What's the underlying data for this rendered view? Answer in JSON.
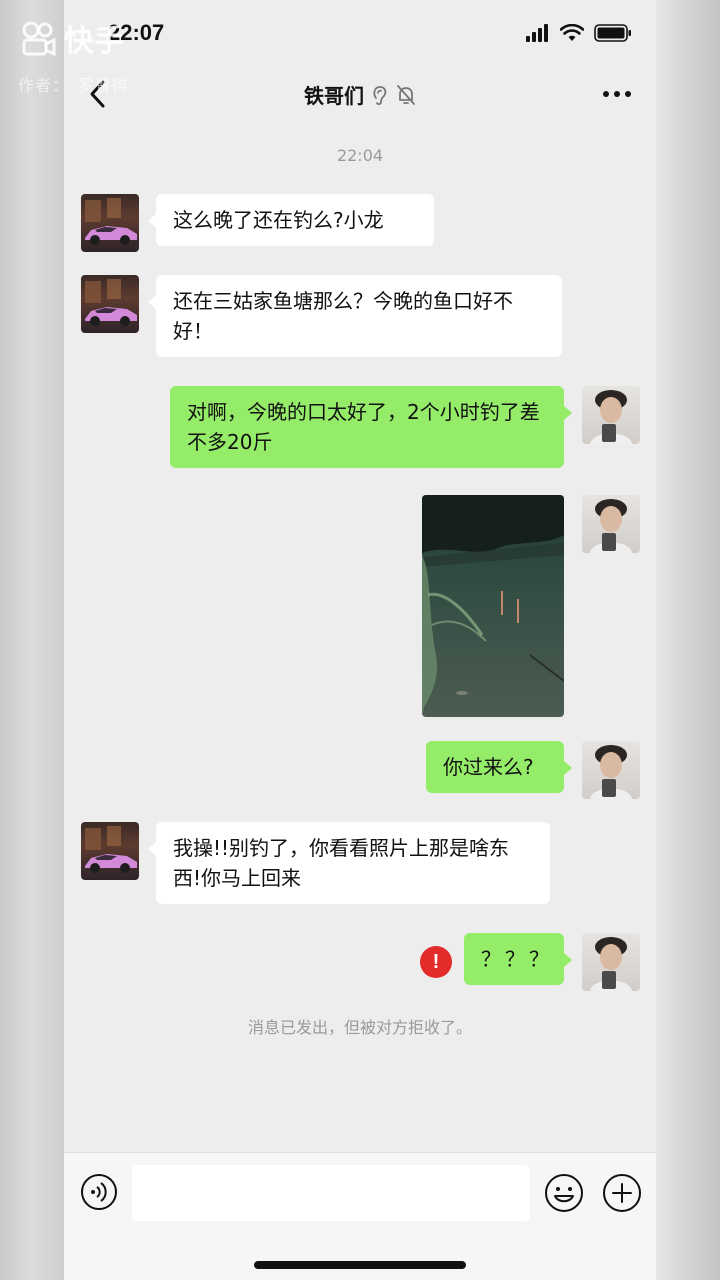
{
  "watermark": {
    "brand": "快手",
    "author": "作者：　罗曹得"
  },
  "status": {
    "time": "22:07"
  },
  "nav": {
    "title": "铁哥们"
  },
  "timestamp": "22:04",
  "messages": [
    {
      "side": "left",
      "text": "这么晚了还在钓么?小龙"
    },
    {
      "side": "left",
      "text": "还在三姑家鱼塘那么？今晚的鱼口好不好！"
    },
    {
      "side": "right",
      "text": "对啊，今晚的口太好了，2个小时钓了差不多20斤"
    },
    {
      "side": "right",
      "type": "image"
    },
    {
      "side": "right",
      "text": "你过来么?"
    },
    {
      "side": "left",
      "text": "我操!!别钓了，你看看照片上那是啥东西!你马上回来"
    },
    {
      "side": "right",
      "text": "？？？",
      "failed": true
    }
  ],
  "error_mark": "!",
  "system_notice": "消息已发出，但被对方拒收了。",
  "input": {
    "value": "",
    "placeholder": ""
  },
  "colors": {
    "bubble_sent": "#95ec69",
    "bubble_received": "#ffffff",
    "chat_bg": "#ededed",
    "error": "#e32b2b"
  }
}
